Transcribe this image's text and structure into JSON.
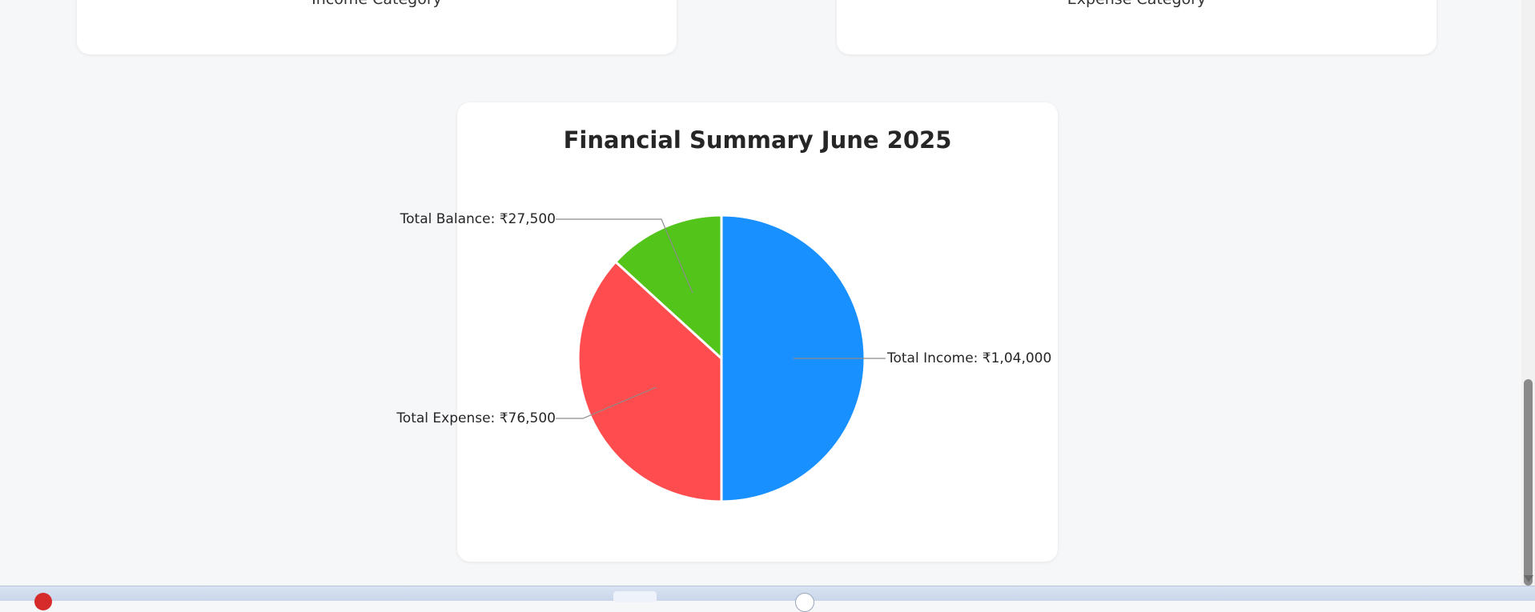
{
  "cards": {
    "income_category": "Income Category",
    "expense_category": "Expense Category"
  },
  "chart_data": {
    "type": "pie",
    "title": "Financial Summary June 2025",
    "currency_symbol": "₹",
    "slices": [
      {
        "name": "Total Income",
        "value": 104000,
        "label": "Total Income: ₹1,04,000",
        "color": "#1890ff"
      },
      {
        "name": "Total Expense",
        "value": 76500,
        "label": "Total Expense: ₹76,500",
        "color": "#ff4d4f"
      },
      {
        "name": "Total Balance",
        "value": 27500,
        "label": "Total Balance: ₹27,500",
        "color": "#52c41a"
      }
    ],
    "start_angle": "top, clockwise",
    "legend": "none"
  }
}
